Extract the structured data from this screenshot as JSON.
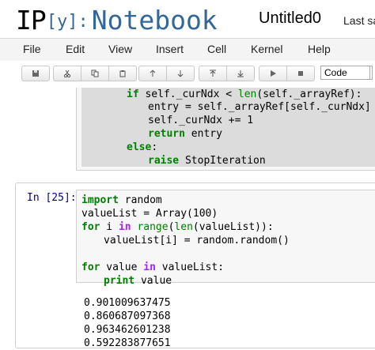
{
  "header": {
    "logo_ip": "IP",
    "logo_y": "[y]:",
    "logo_notebook": "Notebook",
    "notebook_title": "Untitled0",
    "last_saved": "Last sa"
  },
  "menu": {
    "items": [
      "File",
      "Edit",
      "View",
      "Insert",
      "Cell",
      "Kernel",
      "Help"
    ]
  },
  "toolbar": {
    "icons": [
      "save-icon",
      "cut-icon",
      "copy-icon",
      "paste-icon",
      "move-up-icon",
      "move-down-icon",
      "insert-above-icon",
      "insert-below-icon",
      "run-icon",
      "stop-icon"
    ],
    "cell_type": "Code"
  },
  "cell1": {
    "lines": [
      {
        "kw": "if",
        "rest": " self._curNdx < ",
        "bi": "len",
        "tail": "(self._arrayRef):"
      },
      {
        "text": "entry = self._arrayRef[self._curNdx]"
      },
      {
        "text": "self._curNdx += 1"
      },
      {
        "kw": "return",
        "rest": " entry"
      },
      {
        "kw": "else",
        "rest": ":"
      },
      {
        "kw": "raise",
        "rest": " StopIteration"
      }
    ]
  },
  "cell2": {
    "prompt": "In [25]:",
    "code": {
      "l1_kw": "import",
      "l1_rest": " random",
      "l2": "valueList = Array(100)",
      "l3_kw": "for",
      "l3_a": " i ",
      "l3_kw2": "in",
      "l3_sp": " ",
      "l3_bi1": "range",
      "l3_p": "(",
      "l3_bi2": "len",
      "l3_tail": "(valueList)):",
      "l4": "valueList[i] = random.random()",
      "l5_kw": "for",
      "l5_a": " value ",
      "l5_kw2": "in",
      "l5_tail": " valueList:",
      "l6_kw": "print",
      "l6_rest": " value"
    },
    "outputs": [
      "0.901009637475",
      "0.860687097368",
      "0.963462601238",
      "0.592283877651"
    ]
  }
}
